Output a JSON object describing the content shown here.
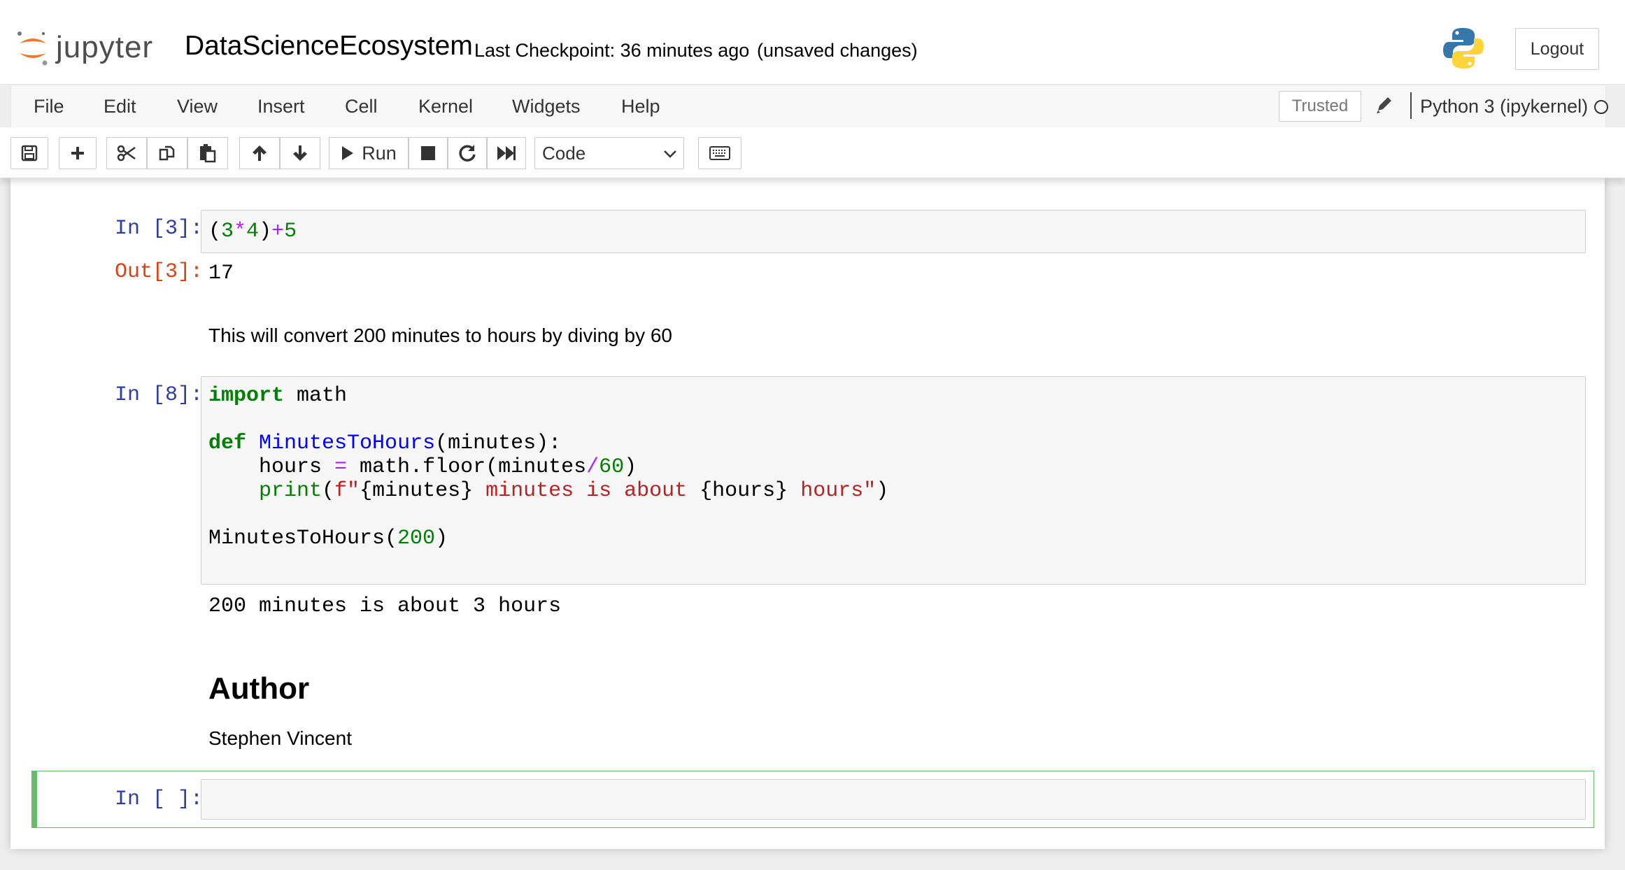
{
  "header": {
    "logo_text": "jupyter",
    "notebook_title": "DataScienceEcosystem",
    "checkpoint_text": "Last Checkpoint: 36 minutes ago",
    "autosave_status": "(unsaved changes)",
    "logout_label": "Logout"
  },
  "menubar": {
    "items": [
      "File",
      "Edit",
      "View",
      "Insert",
      "Cell",
      "Kernel",
      "Widgets",
      "Help"
    ],
    "trusted_label": "Trusted",
    "kernel_name": "Python 3 (ipykernel)"
  },
  "toolbar": {
    "run_label": "Run",
    "cell_type": "Code"
  },
  "cells": {
    "c1": {
      "prompt_in": "In [3]:",
      "code": "(3*4)+5",
      "prompt_out": "Out[3]:",
      "output": "17"
    },
    "md1": {
      "text": "This will convert 200 minutes to hours by diving by 60"
    },
    "c2": {
      "prompt_in": "In [8]:",
      "line1_kw": "import",
      "line1_rest": " math",
      "line2_kw": "def",
      "line2_fn": "MinutesToHours",
      "line2_rest": "(minutes):",
      "line3_pre": "    hours ",
      "line3_op": "=",
      "line3_mid": " math.floor(minutes",
      "line3_op2": "/",
      "line3_num": "60",
      "line3_end": ")",
      "line4_indent": "    ",
      "line4_fn": "print",
      "line4_open": "(",
      "line4_fstr": "f\"",
      "line4_var1": "{minutes}",
      "line4_s2": " minutes is about ",
      "line4_var2": "{hours}",
      "line4_s3": " hours\"",
      "line4_close": ")",
      "line5_call": "MinutesToHours(",
      "line5_num": "200",
      "line5_close": ")",
      "output": "200 minutes is about 3 hours"
    },
    "md2": {
      "heading": "Author",
      "text": "Stephen Vincent"
    },
    "c3": {
      "prompt_in": "In [ ]:"
    }
  },
  "colors": {
    "jupyter_orange": "#f37726",
    "prompt_in": "#303f9f",
    "prompt_out": "#d84315",
    "selected_border": "#66bb6a"
  }
}
